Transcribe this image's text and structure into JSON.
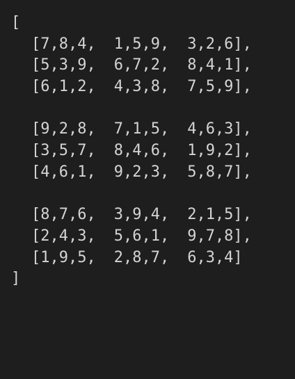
{
  "editor": {
    "open_bracket": "[",
    "close_bracket": "]",
    "blocks": [
      {
        "rows": [
          {
            "groups": [
              "[7,8,4,",
              "1,5,9,",
              "3,2,6],"
            ]
          },
          {
            "groups": [
              "[5,3,9,",
              "6,7,2,",
              "8,4,1],"
            ]
          },
          {
            "groups": [
              "[6,1,2,",
              "4,3,8,",
              "7,5,9],"
            ]
          }
        ]
      },
      {
        "rows": [
          {
            "groups": [
              "[9,2,8,",
              "7,1,5,",
              "4,6,3],"
            ]
          },
          {
            "groups": [
              "[3,5,7,",
              "8,4,6,",
              "1,9,2],"
            ]
          },
          {
            "groups": [
              "[4,6,1,",
              "9,2,3,",
              "5,8,7],"
            ]
          }
        ]
      },
      {
        "rows": [
          {
            "groups": [
              "[8,7,6,",
              "3,9,4,",
              "2,1,5],"
            ]
          },
          {
            "groups": [
              "[2,4,3,",
              "5,6,1,",
              "9,7,8],"
            ]
          },
          {
            "groups": [
              "[1,9,5,",
              "2,8,7,",
              "6,3,4]"
            ]
          }
        ]
      }
    ]
  }
}
